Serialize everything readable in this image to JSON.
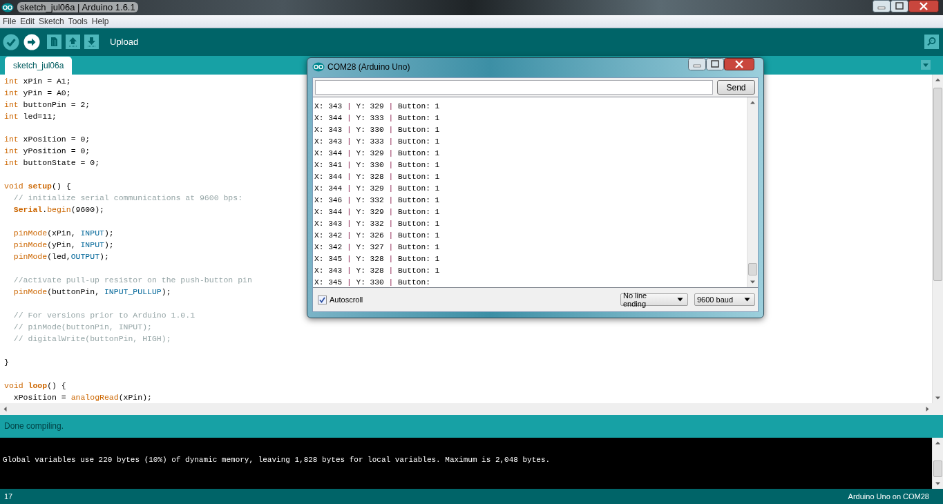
{
  "window": {
    "title": "sketch_jul06a | Arduino 1.6.1"
  },
  "menu": [
    "File",
    "Edit",
    "Sketch",
    "Tools",
    "Help"
  ],
  "toolbar": {
    "buttons": [
      {
        "kind": "verify",
        "hovered": false
      },
      {
        "kind": "upload",
        "hovered": true
      },
      {
        "kind": "new",
        "hovered": false
      },
      {
        "kind": "open",
        "hovered": false
      },
      {
        "kind": "save",
        "hovered": false
      }
    ],
    "hover_label": "Upload"
  },
  "tabs": [
    {
      "label": "sketch_jul06a",
      "selected": true
    }
  ],
  "editor": {
    "lines": [
      {
        "kind": "code",
        "parts": [
          {
            "kind": "type",
            "text": "int"
          },
          {
            "kind": "plain",
            "text": " xPin = A1;"
          }
        ]
      },
      {
        "kind": "code",
        "parts": [
          {
            "kind": "type",
            "text": "int"
          },
          {
            "kind": "plain",
            "text": " yPin = A0;"
          }
        ]
      },
      {
        "kind": "code",
        "parts": [
          {
            "kind": "type",
            "text": "int"
          },
          {
            "kind": "plain",
            "text": " buttonPin = 2;"
          }
        ]
      },
      {
        "kind": "code",
        "parts": [
          {
            "kind": "type",
            "text": "int"
          },
          {
            "kind": "plain",
            "text": " led=11;"
          }
        ]
      },
      {
        "kind": "blank"
      },
      {
        "kind": "code",
        "parts": [
          {
            "kind": "type",
            "text": "int"
          },
          {
            "kind": "plain",
            "text": " xPosition = 0;"
          }
        ]
      },
      {
        "kind": "code",
        "parts": [
          {
            "kind": "type",
            "text": "int"
          },
          {
            "kind": "plain",
            "text": " yPosition = 0;"
          }
        ]
      },
      {
        "kind": "code",
        "parts": [
          {
            "kind": "type",
            "text": "int"
          },
          {
            "kind": "plain",
            "text": " buttonState = 0;"
          }
        ]
      },
      {
        "kind": "blank"
      },
      {
        "kind": "code",
        "parts": [
          {
            "kind": "type",
            "text": "void "
          },
          {
            "kind": "function_bold",
            "text": "setup"
          },
          {
            "kind": "plain",
            "text": "() {"
          }
        ]
      },
      {
        "kind": "code",
        "parts": [
          {
            "kind": "comment",
            "text": "  // initialize serial communications at 9600 bps:"
          }
        ]
      },
      {
        "kind": "code",
        "parts": [
          {
            "kind": "function_bold",
            "text": "  Serial"
          },
          {
            "kind": "plain",
            "text": "."
          },
          {
            "kind": "function",
            "text": "begin"
          },
          {
            "kind": "plain",
            "text": "(9600);"
          }
        ]
      },
      {
        "kind": "blank"
      },
      {
        "kind": "code",
        "parts": [
          {
            "kind": "function",
            "text": "  pinMode"
          },
          {
            "kind": "plain",
            "text": "(xPin, "
          },
          {
            "kind": "constant",
            "text": "INPUT"
          },
          {
            "kind": "plain",
            "text": ");"
          }
        ]
      },
      {
        "kind": "code",
        "parts": [
          {
            "kind": "function",
            "text": "  pinMode"
          },
          {
            "kind": "plain",
            "text": "(yPin, "
          },
          {
            "kind": "constant",
            "text": "INPUT"
          },
          {
            "kind": "plain",
            "text": ");"
          }
        ]
      },
      {
        "kind": "code",
        "parts": [
          {
            "kind": "function",
            "text": "  pinMode"
          },
          {
            "kind": "plain",
            "text": "(led,"
          },
          {
            "kind": "constant",
            "text": "OUTPUT"
          },
          {
            "kind": "plain",
            "text": ");"
          }
        ]
      },
      {
        "kind": "blank"
      },
      {
        "kind": "code",
        "parts": [
          {
            "kind": "comment",
            "text": "  //activate pull-up resistor on the push-button pin"
          }
        ]
      },
      {
        "kind": "code",
        "parts": [
          {
            "kind": "function",
            "text": "  pinMode"
          },
          {
            "kind": "plain",
            "text": "(buttonPin, "
          },
          {
            "kind": "constant",
            "text": "INPUT_PULLUP"
          },
          {
            "kind": "plain",
            "text": ");"
          }
        ]
      },
      {
        "kind": "blank"
      },
      {
        "kind": "code",
        "parts": [
          {
            "kind": "comment",
            "text": "  // For versions prior to Arduino 1.0.1"
          }
        ]
      },
      {
        "kind": "code",
        "parts": [
          {
            "kind": "comment",
            "text": "  // pinMode(buttonPin, INPUT);"
          }
        ]
      },
      {
        "kind": "code",
        "parts": [
          {
            "kind": "comment",
            "text": "  // digitalWrite(buttonPin, HIGH);"
          }
        ]
      },
      {
        "kind": "blank"
      },
      {
        "kind": "code",
        "parts": [
          {
            "kind": "plain",
            "text": "}"
          }
        ]
      },
      {
        "kind": "blank"
      },
      {
        "kind": "code",
        "parts": [
          {
            "kind": "type",
            "text": "void "
          },
          {
            "kind": "function_bold",
            "text": "loop"
          },
          {
            "kind": "plain",
            "text": "() {"
          }
        ]
      },
      {
        "kind": "code",
        "parts": [
          {
            "kind": "plain",
            "text": "  xPosition = "
          },
          {
            "kind": "function",
            "text": "analogRead"
          },
          {
            "kind": "plain",
            "text": "(xPin);"
          }
        ]
      }
    ]
  },
  "status": {
    "message": "Done compiling."
  },
  "console": {
    "lines": [
      "Global variables use 220 bytes (10%) of dynamic memory, leaving 1,828 bytes for local variables. Maximum is 2,048 bytes."
    ]
  },
  "footer": {
    "line": "17",
    "board": "Arduino Uno on COM28"
  },
  "serial_monitor": {
    "title": "COM28 (Arduino Uno)",
    "send_label": "Send",
    "lines": [
      {
        "parts": [
          {
            "kind": "value",
            "text": "X: 343"
          },
          {
            "kind": "separator",
            "text": "|"
          },
          {
            "kind": "value",
            "text": "Y: 329"
          },
          {
            "kind": "separator",
            "text": "|"
          },
          {
            "kind": "value",
            "text": "Button: 1"
          }
        ]
      },
      {
        "parts": [
          {
            "kind": "value",
            "text": "X: 344"
          },
          {
            "kind": "separator",
            "text": "|"
          },
          {
            "kind": "value",
            "text": "Y: 333"
          },
          {
            "kind": "separator",
            "text": "|"
          },
          {
            "kind": "value",
            "text": "Button: 1"
          }
        ]
      },
      {
        "parts": [
          {
            "kind": "value",
            "text": "X: 343"
          },
          {
            "kind": "separator",
            "text": "|"
          },
          {
            "kind": "value",
            "text": "Y: 330"
          },
          {
            "kind": "separator",
            "text": "|"
          },
          {
            "kind": "value",
            "text": "Button: 1"
          }
        ]
      },
      {
        "parts": [
          {
            "kind": "value",
            "text": "X: 343"
          },
          {
            "kind": "separator",
            "text": "|"
          },
          {
            "kind": "value",
            "text": "Y: 333"
          },
          {
            "kind": "separator",
            "text": "|"
          },
          {
            "kind": "value",
            "text": "Button: 1"
          }
        ]
      },
      {
        "parts": [
          {
            "kind": "value",
            "text": "X: 344"
          },
          {
            "kind": "separator",
            "text": "|"
          },
          {
            "kind": "value",
            "text": "Y: 329"
          },
          {
            "kind": "separator",
            "text": "|"
          },
          {
            "kind": "value",
            "text": "Button: 1"
          }
        ]
      },
      {
        "parts": [
          {
            "kind": "value",
            "text": "X: 341"
          },
          {
            "kind": "separator",
            "text": "|"
          },
          {
            "kind": "value",
            "text": "Y: 330"
          },
          {
            "kind": "separator",
            "text": "|"
          },
          {
            "kind": "value",
            "text": "Button: 1"
          }
        ]
      },
      {
        "parts": [
          {
            "kind": "value",
            "text": "X: 344"
          },
          {
            "kind": "separator",
            "text": "|"
          },
          {
            "kind": "value",
            "text": "Y: 328"
          },
          {
            "kind": "separator",
            "text": "|"
          },
          {
            "kind": "value",
            "text": "Button: 1"
          }
        ]
      },
      {
        "parts": [
          {
            "kind": "value",
            "text": "X: 344"
          },
          {
            "kind": "separator",
            "text": "|"
          },
          {
            "kind": "value",
            "text": "Y: 329"
          },
          {
            "kind": "separator",
            "text": "|"
          },
          {
            "kind": "value",
            "text": "Button: 1"
          }
        ]
      },
      {
        "parts": [
          {
            "kind": "value",
            "text": "X: 346"
          },
          {
            "kind": "separator",
            "text": "|"
          },
          {
            "kind": "value",
            "text": "Y: 332"
          },
          {
            "kind": "separator",
            "text": "|"
          },
          {
            "kind": "value",
            "text": "Button: 1"
          }
        ]
      },
      {
        "parts": [
          {
            "kind": "value",
            "text": "X: 344"
          },
          {
            "kind": "separator",
            "text": "|"
          },
          {
            "kind": "value",
            "text": "Y: 329"
          },
          {
            "kind": "separator",
            "text": "|"
          },
          {
            "kind": "value",
            "text": "Button: 1"
          }
        ]
      },
      {
        "parts": [
          {
            "kind": "value",
            "text": "X: 343"
          },
          {
            "kind": "separator",
            "text": "|"
          },
          {
            "kind": "value",
            "text": "Y: 332"
          },
          {
            "kind": "separator",
            "text": "|"
          },
          {
            "kind": "value",
            "text": "Button: 1"
          }
        ]
      },
      {
        "parts": [
          {
            "kind": "value",
            "text": "X: 342"
          },
          {
            "kind": "separator",
            "text": "|"
          },
          {
            "kind": "value",
            "text": "Y: 326"
          },
          {
            "kind": "separator",
            "text": "|"
          },
          {
            "kind": "value",
            "text": "Button: 1"
          }
        ]
      },
      {
        "parts": [
          {
            "kind": "value",
            "text": "X: 342"
          },
          {
            "kind": "separator",
            "text": "|"
          },
          {
            "kind": "value",
            "text": "Y: 327"
          },
          {
            "kind": "separator",
            "text": "|"
          },
          {
            "kind": "value",
            "text": "Button: 1"
          }
        ]
      },
      {
        "parts": [
          {
            "kind": "value",
            "text": "X: 345"
          },
          {
            "kind": "separator",
            "text": "|"
          },
          {
            "kind": "value",
            "text": "Y: 328"
          },
          {
            "kind": "separator",
            "text": "|"
          },
          {
            "kind": "value",
            "text": "Button: 1"
          }
        ]
      },
      {
        "parts": [
          {
            "kind": "value",
            "text": "X: 343"
          },
          {
            "kind": "separator",
            "text": "|"
          },
          {
            "kind": "value",
            "text": "Y: 328"
          },
          {
            "kind": "separator",
            "text": "|"
          },
          {
            "kind": "value",
            "text": "Button: 1"
          }
        ]
      },
      {
        "parts": [
          {
            "kind": "value",
            "text": "X: 345"
          },
          {
            "kind": "separator",
            "text": "|"
          },
          {
            "kind": "value",
            "text": "Y: 330"
          },
          {
            "kind": "separator",
            "text": "|"
          },
          {
            "kind": "value",
            "text": "Button:"
          }
        ]
      }
    ],
    "autoscroll": {
      "label": "Autoscroll",
      "checked": true
    },
    "line_ending": "No line ending",
    "baud": "9600 baud"
  }
}
